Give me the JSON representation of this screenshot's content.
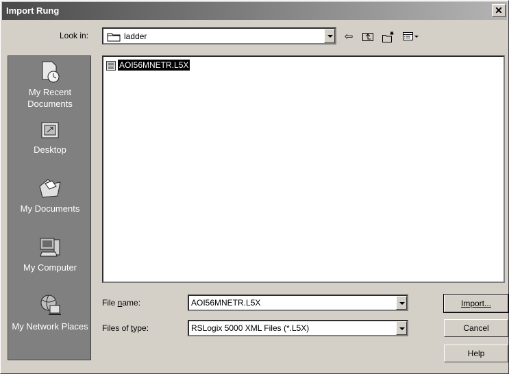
{
  "window": {
    "title": "Import Rung"
  },
  "look_in": {
    "label": "Look in:",
    "value": "ladder"
  },
  "toolbar": {
    "icons": [
      "back-icon",
      "up-folder-icon",
      "new-folder-icon",
      "view-menu-icon"
    ]
  },
  "places": [
    {
      "label": "My Recent Documents",
      "icon": "recent-documents-icon"
    },
    {
      "label": "Desktop",
      "icon": "desktop-icon"
    },
    {
      "label": "My Documents",
      "icon": "my-documents-icon"
    },
    {
      "label": "My Computer",
      "icon": "my-computer-icon"
    },
    {
      "label": "My Network Places",
      "icon": "network-places-icon"
    }
  ],
  "files": [
    {
      "name": "AOI56MNETR.L5X",
      "selected": true
    }
  ],
  "file_name": {
    "label": "File name:",
    "value": "AOI56MNETR.L5X"
  },
  "file_type": {
    "label": "Files of type:",
    "value": "RSLogix 5000 XML Files (*.L5X)"
  },
  "buttons": {
    "import": "Import...",
    "cancel": "Cancel",
    "help": "Help"
  },
  "colors": {
    "titlebar_start": "#4a4a4a",
    "places_bg": "#808080",
    "selection_bg": "#000000"
  }
}
